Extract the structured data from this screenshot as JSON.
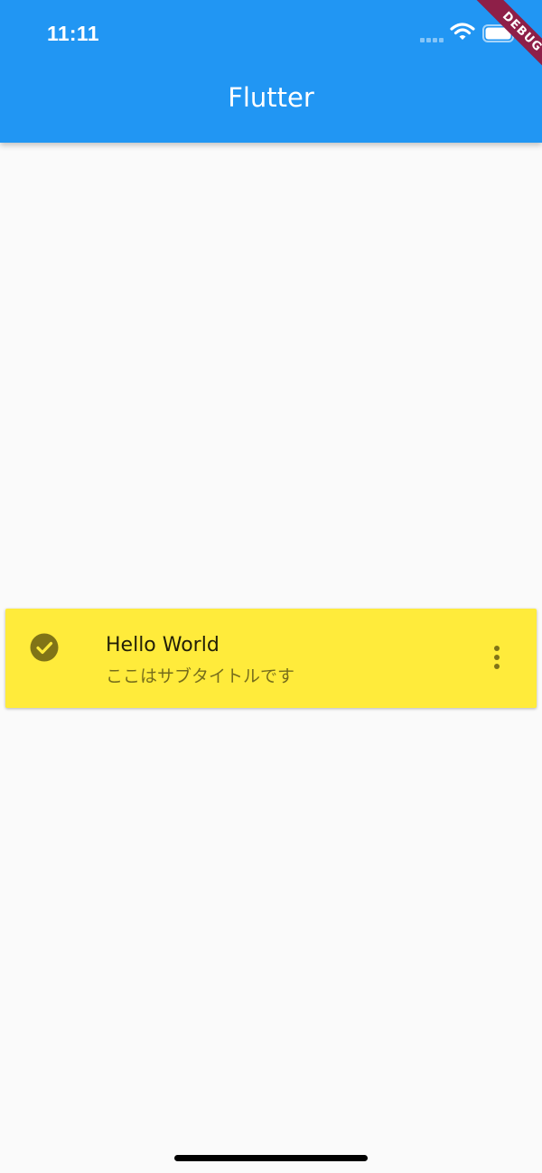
{
  "colors": {
    "app_bar": "#2196F3",
    "background": "#FAFAFA",
    "tile": "#FFEB3B",
    "icon": "#807417",
    "debug_banner": "#8E1F48"
  },
  "status_bar": {
    "time": "11:11",
    "icons": [
      "signal-icon",
      "wifi-icon",
      "battery-icon"
    ]
  },
  "app_bar": {
    "title": "Flutter"
  },
  "debug_banner": {
    "label": "DEBUG"
  },
  "tile": {
    "leading_icon": "check-circle-icon",
    "title": "Hello World",
    "subtitle": "ここはサブタイトルです",
    "trailing_icon": "more-vert-icon"
  }
}
